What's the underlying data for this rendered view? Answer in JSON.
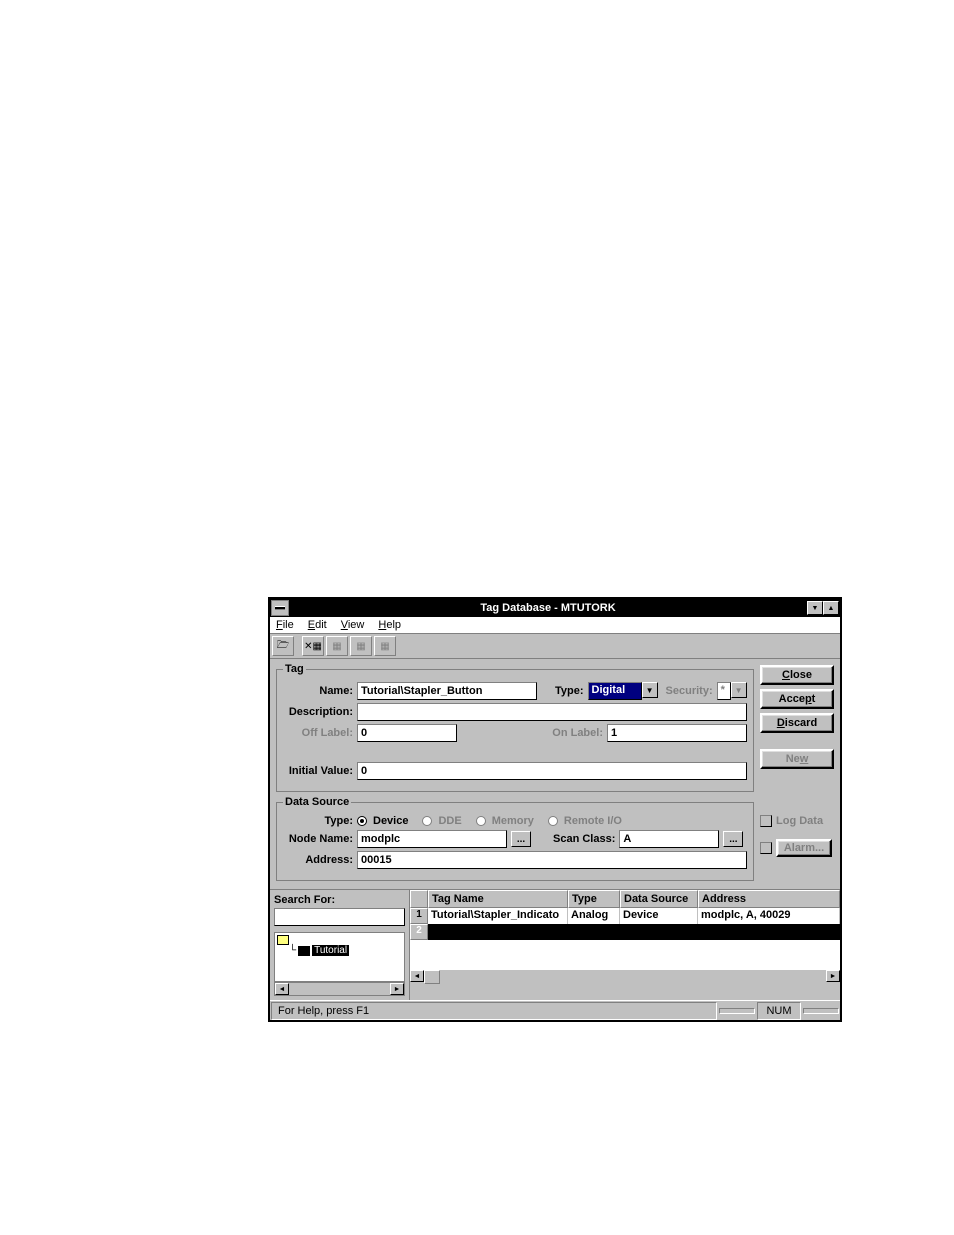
{
  "window": {
    "title": "Tag Database - MTUTORK"
  },
  "menu": {
    "file": "File",
    "edit": "Edit",
    "view": "View",
    "help": "Help"
  },
  "tag_group": {
    "legend": "Tag",
    "name_label": "Name:",
    "name_value": "Tutorial\\Stapler_Button",
    "type_label": "Type:",
    "type_value": "Digital",
    "security_label": "Security:",
    "security_value": "*",
    "description_label": "Description:",
    "description_value": "",
    "off_label": "Off Label:",
    "off_value": "0",
    "on_label": "On Label:",
    "on_value": "1",
    "initial_label": "Initial Value:",
    "initial_value": "0"
  },
  "data_source": {
    "legend": "Data Source",
    "type_label": "Type:",
    "opt_device": "Device",
    "opt_dde": "DDE",
    "opt_memory": "Memory",
    "opt_remote": "Remote I/O",
    "node_label": "Node Name:",
    "node_value": "modplc",
    "scan_label": "Scan Class:",
    "scan_value": "A",
    "address_label": "Address:",
    "address_value": "00015"
  },
  "buttons": {
    "close": "Close",
    "accept": "Accept",
    "discard": "Discard",
    "new": "New",
    "log_data": "Log Data",
    "alarm": "Alarm..."
  },
  "search": {
    "label": "Search For:",
    "value": "",
    "tree_root": "",
    "tree_child": "Tutorial"
  },
  "table": {
    "headers": {
      "tagname": "Tag Name",
      "type": "Type",
      "datasource": "Data Source",
      "address": "Address"
    },
    "rows": [
      {
        "num": "1",
        "tagname": "Tutorial\\Stapler_Indicato",
        "type": "Analog",
        "datasource": "Device",
        "address": "modplc, A, 40029"
      },
      {
        "num": "2",
        "tagname": "",
        "type": "",
        "datasource": "",
        "address": ""
      }
    ]
  },
  "status": {
    "help": "For Help, press F1",
    "num": "NUM"
  }
}
